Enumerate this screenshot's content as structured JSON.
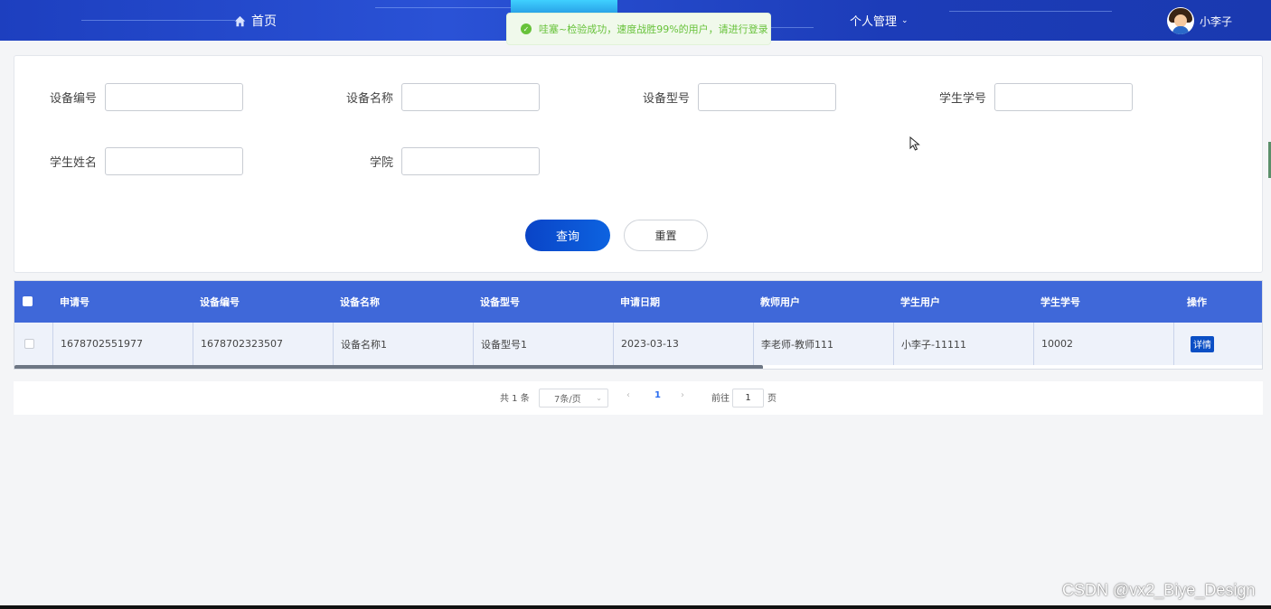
{
  "nav": {
    "home_label": "首页",
    "personal_label": "个人管理",
    "username": "小李子"
  },
  "toast": {
    "message": "哇塞~检验成功，速度战胜99%的用户，请进行登录",
    "color": "#67c23a"
  },
  "search": {
    "fields": [
      {
        "label": "设备编号",
        "value": ""
      },
      {
        "label": "设备名称",
        "value": ""
      },
      {
        "label": "设备型号",
        "value": ""
      },
      {
        "label": "学生学号",
        "value": ""
      },
      {
        "label": "学生姓名",
        "value": ""
      },
      {
        "label": "学院",
        "value": ""
      }
    ],
    "query_label": "查询",
    "reset_label": "重置"
  },
  "table": {
    "header_color": "#3f68d9",
    "columns": [
      "申请号",
      "设备编号",
      "设备名称",
      "设备型号",
      "申请日期",
      "教师用户",
      "学生用户",
      "学生学号",
      "操作"
    ],
    "rows": [
      [
        "1678702551977",
        "1678702323507",
        "设备名称1",
        "设备型号1",
        "2023-03-13",
        "李老师-教师111",
        "小李子-11111",
        "10002"
      ]
    ],
    "detail_label": "详情"
  },
  "pager": {
    "total": "共 1 条",
    "page_size": "7条/页",
    "current_page": "1",
    "goto_label": "前往",
    "goto_value": "1",
    "page_unit": "页"
  },
  "watermark": "CSDN @vx2_Biye_Design",
  "icons": {
    "home": "home-icon",
    "success": "check-circle-icon",
    "dropdown": "chevron-down-icon",
    "prev": "chevron-left-icon",
    "next": "chevron-right-icon"
  }
}
